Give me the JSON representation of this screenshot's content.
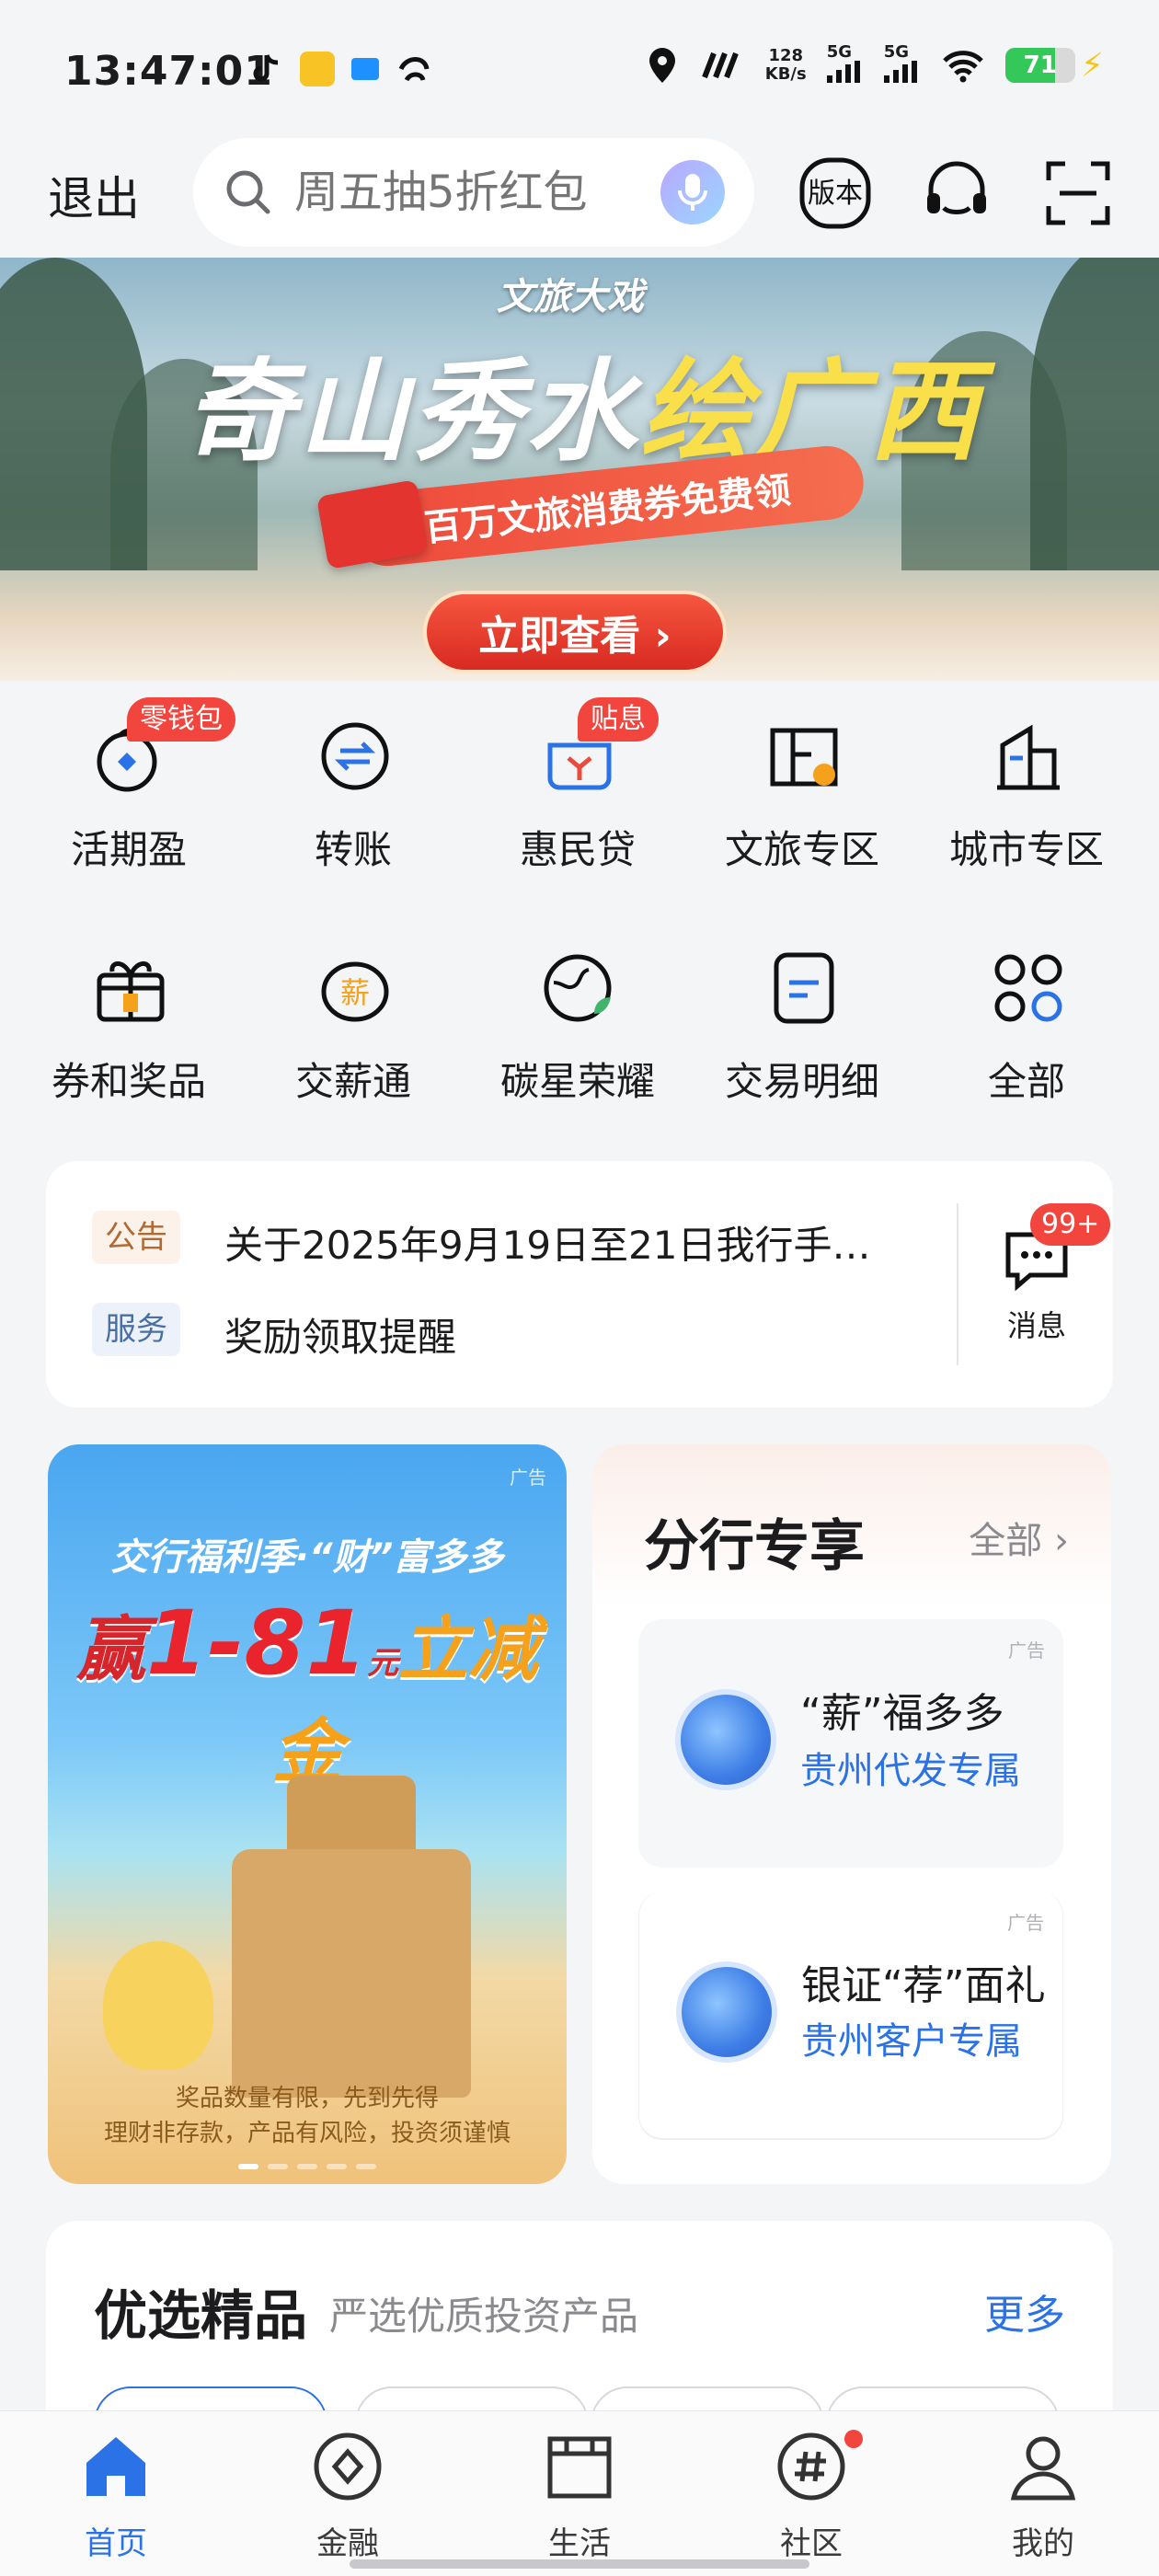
{
  "status_bar": {
    "time": "13:47:01",
    "net_speed_value": "128",
    "net_speed_unit": "KB/s",
    "sim1": "5G",
    "sim2": "5G",
    "battery": "71",
    "battery_level": 0.71,
    "colors": {
      "battery": "#34c759"
    }
  },
  "header": {
    "exit_label": "退出",
    "search_placeholder": "周五抽5折红包",
    "version_label": "版本",
    "icons": [
      "search-icon",
      "mic-icon",
      "version-icon",
      "headset-icon",
      "scan-icon"
    ]
  },
  "banner": {
    "subtitle": "文旅大戏",
    "title_main": "奇山秀水",
    "title_accent": "绘广西",
    "ribbon": "百万文旅消费券免费领",
    "cta": "立即查看 ›"
  },
  "grid": {
    "row1": [
      {
        "label": "活期盈",
        "badge": "零钱包",
        "icon": "wallet-icon"
      },
      {
        "label": "转账",
        "badge": "",
        "icon": "transfer-icon"
      },
      {
        "label": "惠民贷",
        "badge": "贴息",
        "icon": "loan-icon"
      },
      {
        "label": "文旅专区",
        "badge": "",
        "icon": "travel-icon"
      },
      {
        "label": "城市专区",
        "badge": "",
        "icon": "city-icon"
      }
    ],
    "row2": [
      {
        "label": "券和奖品",
        "icon": "gift-icon"
      },
      {
        "label": "交薪通",
        "icon": "salary-icon"
      },
      {
        "label": "碳星荣耀",
        "icon": "earth-icon"
      },
      {
        "label": "交易明细",
        "icon": "document-icon"
      },
      {
        "label": "全部",
        "icon": "apps-icon"
      }
    ]
  },
  "notice": {
    "announcement_tag": "公告",
    "announcement_text": "关于2025年9月19日至21日我行手…",
    "service_tag": "服务",
    "service_text": "奖励领取提醒",
    "message_label": "消息",
    "message_count": "99+"
  },
  "promo": {
    "ad_tag": "广告",
    "subtitle": "交行福利季·“财”富多多",
    "prefix": "赢",
    "amount": "1-81",
    "unit": "元",
    "suffix": "立减金",
    "footnote1": "奖品数量有限，先到先得",
    "footnote2": "理财非存款，产品有风险，投资须谨慎"
  },
  "branch": {
    "title": "分行专享",
    "all_label": "全部 ›",
    "items": [
      {
        "ad_tag": "广告",
        "title": "“薪”福多多",
        "subtitle": "贵州代发专属"
      },
      {
        "ad_tag": "广告",
        "title": "银证“荐”面礼",
        "subtitle": "贵州客户专属"
      }
    ]
  },
  "featured": {
    "title": "优选精品",
    "subtitle": "严选优质投资产品",
    "more_label": "更多"
  },
  "bottom_nav": [
    {
      "label": "首页",
      "icon": "home-icon",
      "active": true
    },
    {
      "label": "金融",
      "icon": "finance-icon",
      "active": false
    },
    {
      "label": "生活",
      "icon": "life-icon",
      "active": false
    },
    {
      "label": "社区",
      "icon": "community-icon",
      "active": false
    },
    {
      "label": "我的",
      "icon": "profile-icon",
      "active": false
    }
  ],
  "colors": {
    "accent": "#2a72e5",
    "badge": "#f2453d",
    "cta": "#d82a22"
  }
}
